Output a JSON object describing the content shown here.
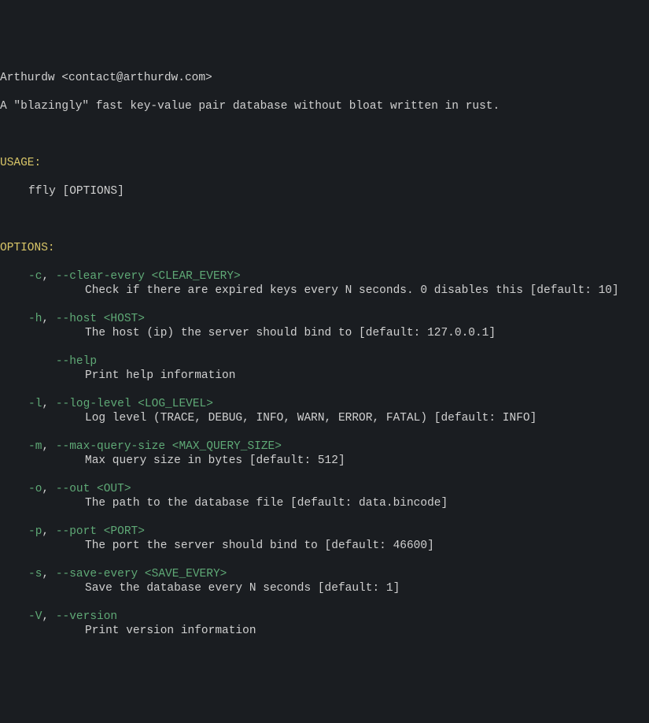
{
  "header": {
    "author": "Arthurdw <contact@arthurdw.com>",
    "description": "A \"blazingly\" fast key-value pair database without bloat written in rust."
  },
  "usage": {
    "heading": "USAGE:",
    "command": "ffly [OPTIONS]"
  },
  "options": {
    "heading": "OPTIONS:",
    "items": [
      {
        "short": "-c",
        "sep": ", ",
        "long": "--clear-every <CLEAR_EVERY>",
        "desc": "Check if there are expired keys every N seconds. 0 disables this [default: 10]"
      },
      {
        "short": "-h",
        "sep": ", ",
        "long": "--host <HOST>",
        "desc": "The host (ip) the server should bind to [default: 127.0.0.1]"
      },
      {
        "short": "",
        "sep": "    ",
        "long": "--help",
        "desc": "Print help information"
      },
      {
        "short": "-l",
        "sep": ", ",
        "long": "--log-level <LOG_LEVEL>",
        "desc": "Log level (TRACE, DEBUG, INFO, WARN, ERROR, FATAL) [default: INFO]"
      },
      {
        "short": "-m",
        "sep": ", ",
        "long": "--max-query-size <MAX_QUERY_SIZE>",
        "desc": "Max query size in bytes [default: 512]"
      },
      {
        "short": "-o",
        "sep": ", ",
        "long": "--out <OUT>",
        "desc": "The path to the database file [default: data.bincode]"
      },
      {
        "short": "-p",
        "sep": ", ",
        "long": "--port <PORT>",
        "desc": "The port the server should bind to [default: 46600]"
      },
      {
        "short": "-s",
        "sep": ", ",
        "long": "--save-every <SAVE_EVERY>",
        "desc": "Save the database every N seconds [default: 1]"
      },
      {
        "short": "-V",
        "sep": ", ",
        "long": "--version",
        "desc": "Print version information"
      }
    ]
  }
}
